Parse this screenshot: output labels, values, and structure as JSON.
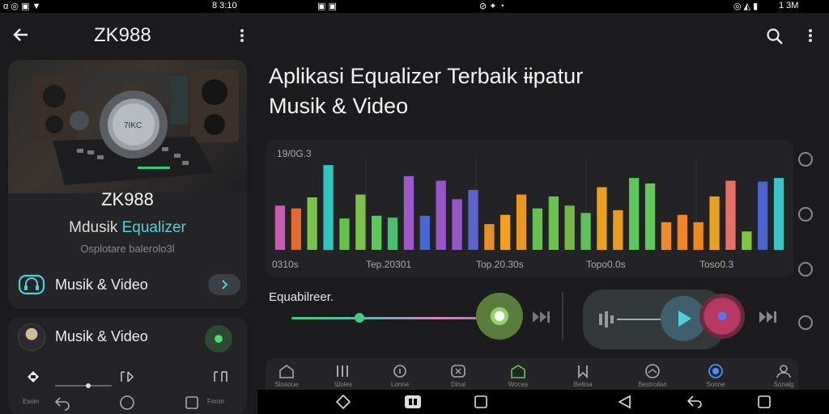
{
  "status_bar": {
    "left_icons": "α ◎ ▣ ▼",
    "mid_time": "8 3:10",
    "mid2": "▣ ▣",
    "right_mid": "⊘ ✦ ◔",
    "right_time": "1 3M",
    "right_icons": "◎ ◭ ▮"
  },
  "left_app": {
    "title": "ZK988",
    "hero": {
      "name": "ZK988",
      "sub_prefix": "Mdusik ",
      "sub_accent": "Equalizer",
      "caption": "Osplotare balerolo3l",
      "headphone_label": "7IKC"
    },
    "row1_label": "Musik & Video",
    "row2_label": "Musik & Video",
    "mini_labels": [
      "Esoin",
      "Foron"
    ]
  },
  "right_app": {
    "headline_line1": "Aplikasi Equalizer Terbaik ",
    "headline_line2": "Musik & Video",
    "headline_tail": "ɨɨpatur",
    "chart_title": "19/0G.3",
    "equalizer_label": "Equabilreer.",
    "bottom_nav": [
      {
        "icon": "home-icon",
        "label": "Sloaoue"
      },
      {
        "icon": "bars-icon",
        "label": "Ɯoles"
      },
      {
        "icon": "info-icon",
        "label": "Lonne"
      },
      {
        "icon": "video-icon",
        "label": "Dinal"
      },
      {
        "icon": "store-icon",
        "label": "Woces"
      },
      {
        "icon": "bookmark-icon",
        "label": "Beltoa"
      },
      {
        "icon": "dashboard-icon",
        "label": "Bestroilan"
      },
      {
        "icon": "eq-icon",
        "label": "Sonne"
      },
      {
        "icon": "user-icon",
        "label": "Sonalg"
      }
    ]
  },
  "chart_data": {
    "type": "bar",
    "title": "19/0G.3",
    "x_tick_labels": [
      "0310s",
      "Tep.20301",
      "Top.20.30s",
      "Topo0.0s",
      "Toso0.3"
    ],
    "values": [
      48,
      45,
      57,
      92,
      34,
      60,
      37,
      35,
      80,
      37,
      75,
      55,
      65,
      28,
      38,
      60,
      45,
      58,
      48,
      40,
      68,
      43,
      78,
      72,
      30,
      38,
      30,
      58,
      75,
      20,
      74,
      78
    ],
    "colors": [
      "#c85ab0",
      "#e56a2f",
      "#78c34d",
      "#2fc7bd",
      "#63c34a",
      "#7dc04a",
      "#5bc857",
      "#46c16b",
      "#9b59c9",
      "#4867d1",
      "#9955c4",
      "#9357c6",
      "#5a64cc",
      "#e88e2b",
      "#f5a01c",
      "#ea9722",
      "#64c250",
      "#6bc04e",
      "#76b844",
      "#5fc05b",
      "#e9a11e",
      "#e89a25",
      "#5bc65a",
      "#62c75c",
      "#f08a2a",
      "#f28424",
      "#f18a1c",
      "#e9a21d",
      "#e86f66",
      "#79c743",
      "#4b62cf",
      "#39c4c7"
    ],
    "ylim": [
      0,
      100
    ]
  },
  "colors": {
    "bg_dark": "#1c1c1e",
    "card": "#252527",
    "accent_teal": "#4fd0d8",
    "accent_green": "#3fcf7d"
  }
}
